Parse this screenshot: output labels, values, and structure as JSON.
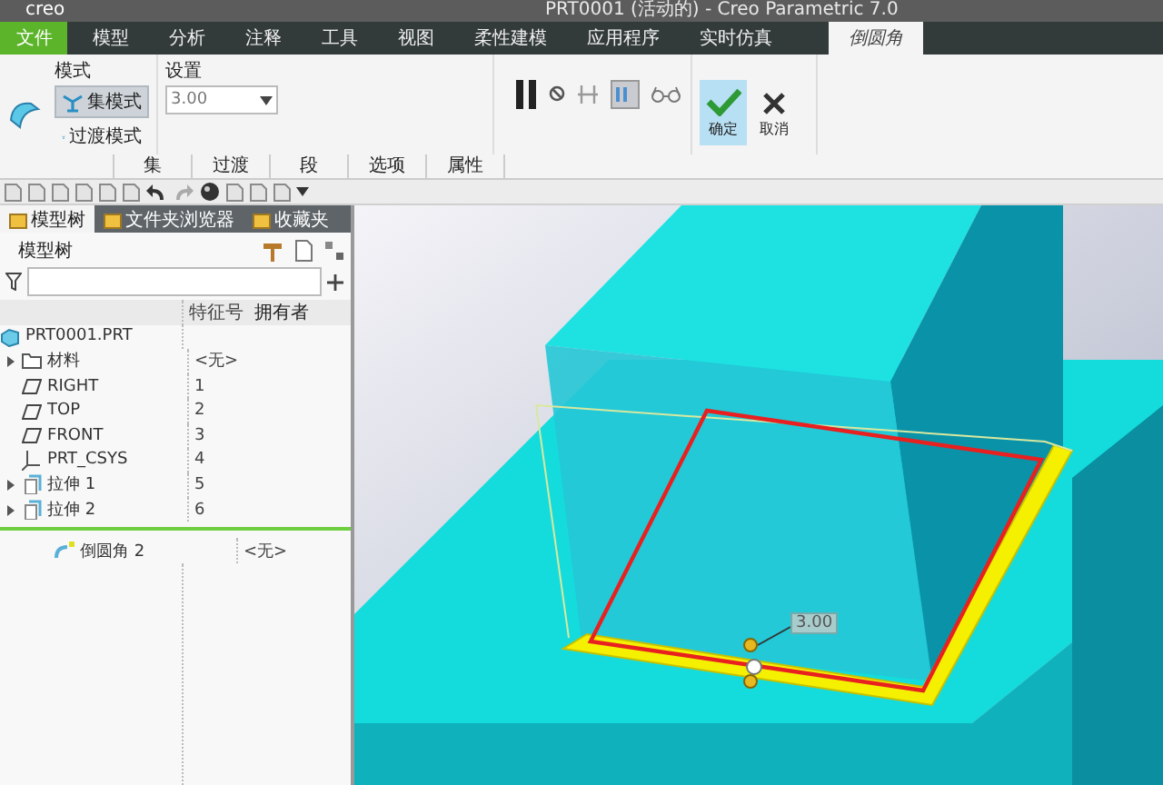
{
  "window": {
    "logo": "creo",
    "title": "PRT0001 (活动的) - Creo Parametric 7.0"
  },
  "menu_tabs": [
    {
      "label": "文件",
      "kind": "file",
      "selected": false
    },
    {
      "label": "模型",
      "kind": "tab",
      "selected": false
    },
    {
      "label": "分析",
      "kind": "tab",
      "selected": false
    },
    {
      "label": "注释",
      "kind": "tab",
      "selected": false
    },
    {
      "label": "工具",
      "kind": "tab",
      "selected": false
    },
    {
      "label": "视图",
      "kind": "tab",
      "selected": false
    },
    {
      "label": "柔性建模",
      "kind": "tab",
      "selected": false
    },
    {
      "label": "应用程序",
      "kind": "tab",
      "selected": false
    },
    {
      "label": "实时仿真",
      "kind": "tab",
      "selected": false
    },
    {
      "label": "倒圆角",
      "kind": "tab",
      "selected": true
    }
  ],
  "ribbon": {
    "mode_label": "模式",
    "modes": [
      {
        "label": "集模式",
        "selected": true
      },
      {
        "label": "过渡模式",
        "selected": false
      }
    ],
    "settings_label": "设置",
    "settings_value": "3.00",
    "panel_tabs": [
      "集",
      "过渡",
      "段",
      "选项",
      "属性"
    ],
    "confirm": "确定",
    "cancel": "取消"
  },
  "model_tree": {
    "tabs": [
      {
        "label": "模型树",
        "selected": true
      },
      {
        "label": "文件夹浏览器",
        "selected": false
      },
      {
        "label": "收藏夹",
        "selected": false
      }
    ],
    "title": "模型树",
    "columns": [
      "特征号",
      "拥有者"
    ],
    "root": "PRT0001.PRT",
    "items": [
      {
        "kind": "folder",
        "label": "材料",
        "expandable": true,
        "feature_no": "<无>"
      },
      {
        "kind": "plane",
        "label": "RIGHT",
        "expandable": false,
        "feature_no": "1"
      },
      {
        "kind": "plane",
        "label": "TOP",
        "expandable": false,
        "feature_no": "2"
      },
      {
        "kind": "plane",
        "label": "FRONT",
        "expandable": false,
        "feature_no": "3"
      },
      {
        "kind": "csys",
        "label": "PRT_CSYS",
        "expandable": false,
        "feature_no": "4"
      },
      {
        "kind": "extrude",
        "label": "拉伸 1",
        "expandable": true,
        "feature_no": "5"
      },
      {
        "kind": "extrude",
        "label": "拉伸 2",
        "expandable": true,
        "feature_no": "6"
      }
    ],
    "inserted_items": [
      {
        "kind": "round",
        "label": "倒圆角 2",
        "feature_no": "<无>"
      }
    ]
  },
  "viewport": {
    "dimension": "3.00"
  }
}
